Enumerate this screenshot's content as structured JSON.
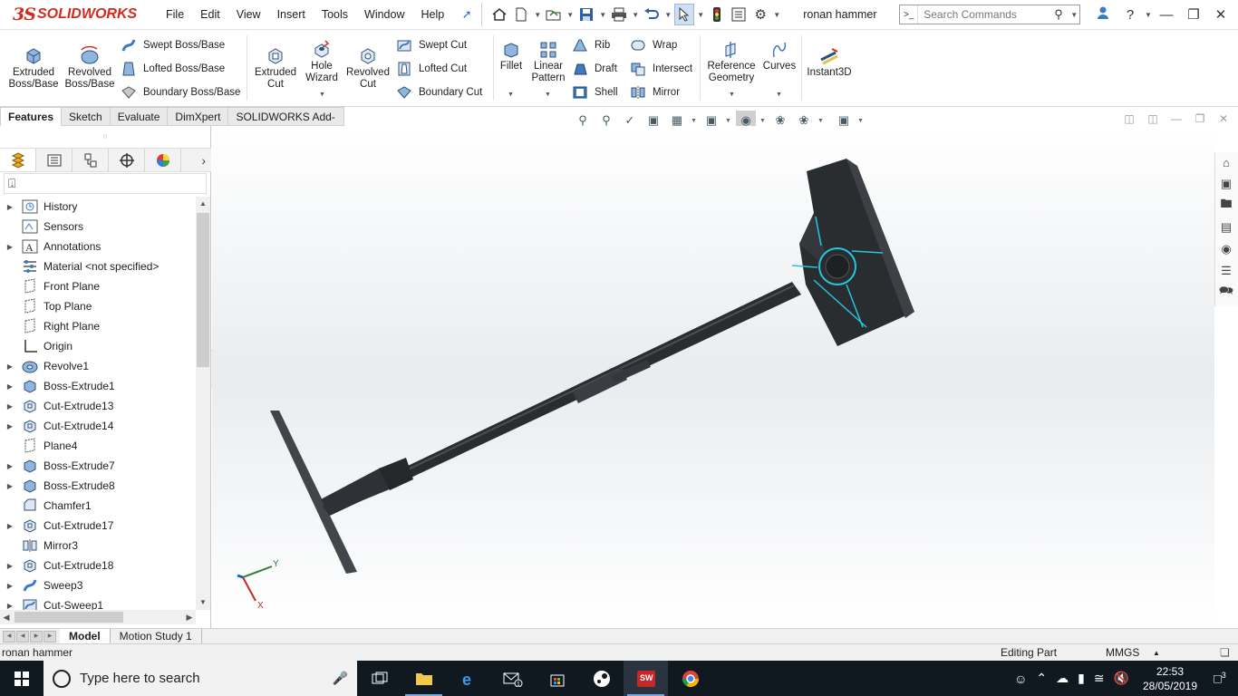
{
  "app": {
    "brand_ds": "3S",
    "brand_name": "SOLIDWORKS",
    "doc_title": "ronan hammer"
  },
  "menu": [
    "File",
    "Edit",
    "View",
    "Insert",
    "Tools",
    "Window",
    "Help"
  ],
  "search": {
    "placeholder": "Search Commands"
  },
  "ribbon": {
    "extruded_boss": [
      "Extruded",
      "Boss/Base"
    ],
    "revolved_boss": [
      "Revolved",
      "Boss/Base"
    ],
    "swept_boss": "Swept Boss/Base",
    "lofted_boss": "Lofted Boss/Base",
    "boundary_boss": "Boundary Boss/Base",
    "extruded_cut": [
      "Extruded",
      "Cut"
    ],
    "hole_wizard": [
      "Hole",
      "Wizard"
    ],
    "revolved_cut": [
      "Revolved",
      "Cut"
    ],
    "swept_cut": "Swept Cut",
    "lofted_cut": "Lofted Cut",
    "boundary_cut": "Boundary Cut",
    "fillet": "Fillet",
    "linear_pattern": [
      "Linear",
      "Pattern"
    ],
    "rib": "Rib",
    "draft": "Draft",
    "shell": "Shell",
    "wrap": "Wrap",
    "intersect": "Intersect",
    "mirror": "Mirror",
    "reference_geometry": [
      "Reference",
      "Geometry"
    ],
    "curves": "Curves",
    "instant3d": "Instant3D"
  },
  "command_tabs": [
    "Features",
    "Sketch",
    "Evaluate",
    "DimXpert",
    "SOLIDWORKS Add-Ins"
  ],
  "tree": [
    {
      "label": "History",
      "expand": true,
      "icon": "history-icon"
    },
    {
      "label": "Sensors",
      "expand": false,
      "icon": "sensors-icon"
    },
    {
      "label": "Annotations",
      "expand": true,
      "icon": "annotations-icon"
    },
    {
      "label": "Material <not specified>",
      "expand": false,
      "icon": "material-icon"
    },
    {
      "label": "Front Plane",
      "expand": false,
      "icon": "plane-icon"
    },
    {
      "label": "Top Plane",
      "expand": false,
      "icon": "plane-icon"
    },
    {
      "label": "Right Plane",
      "expand": false,
      "icon": "plane-icon"
    },
    {
      "label": "Origin",
      "expand": false,
      "icon": "origin-icon"
    },
    {
      "label": "Revolve1",
      "expand": true,
      "icon": "revolve-icon"
    },
    {
      "label": "Boss-Extrude1",
      "expand": true,
      "icon": "extrude-icon"
    },
    {
      "label": "Cut-Extrude13",
      "expand": true,
      "icon": "cut-extrude-icon"
    },
    {
      "label": "Cut-Extrude14",
      "expand": true,
      "icon": "cut-extrude-icon"
    },
    {
      "label": "Plane4",
      "expand": false,
      "icon": "plane-icon"
    },
    {
      "label": "Boss-Extrude7",
      "expand": true,
      "icon": "extrude-icon"
    },
    {
      "label": "Boss-Extrude8",
      "expand": true,
      "icon": "extrude-icon"
    },
    {
      "label": "Chamfer1",
      "expand": false,
      "icon": "chamfer-icon"
    },
    {
      "label": "Cut-Extrude17",
      "expand": true,
      "icon": "cut-extrude-icon"
    },
    {
      "label": "Mirror3",
      "expand": false,
      "icon": "mirror-icon"
    },
    {
      "label": "Cut-Extrude18",
      "expand": true,
      "icon": "cut-extrude-icon"
    },
    {
      "label": "Sweep3",
      "expand": true,
      "icon": "sweep-icon"
    },
    {
      "label": "Cut-Sweep1",
      "expand": true,
      "icon": "cut-sweep-icon"
    }
  ],
  "triad": {
    "x": "X",
    "y": "Y"
  },
  "bottom_tabs": [
    "Model",
    "Motion Study 1"
  ],
  "status": {
    "filename": "ronan hammer",
    "mode": "Editing Part",
    "units": "MMGS"
  },
  "taskbar": {
    "search_placeholder": "Type here to search",
    "time": "22:53",
    "date": "28/05/2019",
    "notifications": "3",
    "mail_badge": "1"
  },
  "colors": {
    "brand_red": "#d52b1e",
    "edge_cyan": "#22c7e0",
    "model_dark": "#2a2d30"
  }
}
